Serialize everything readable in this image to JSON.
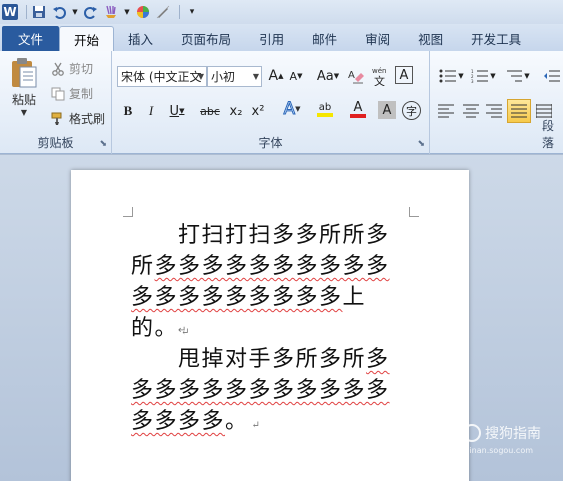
{
  "quick_access": {
    "app_icon": "word-logo",
    "items": [
      "save-icon",
      "undo-icon",
      "redo-icon",
      "format-painter-icon",
      "color-wheel-icon",
      "pen-icon",
      "customize-icon"
    ]
  },
  "tabs": [
    "文件",
    "开始",
    "插入",
    "页面布局",
    "引用",
    "邮件",
    "审阅",
    "视图",
    "开发工具"
  ],
  "ribbon": {
    "clipboard": {
      "label": "剪贴板",
      "paste": "粘贴",
      "cut": "剪切",
      "copy": "复制",
      "format_painter": "格式刷"
    },
    "font": {
      "label": "字体",
      "font_name": "宋体 (中文正文",
      "font_size": "小初",
      "grow": "A",
      "shrink": "A",
      "change_case": "Aa",
      "clear": "A",
      "phonetic": "wén",
      "border": "A",
      "bold": "B",
      "italic": "I",
      "underline": "U",
      "strike": "abc",
      "subscript": "x₂",
      "superscript": "x²",
      "effects": "A",
      "highlight": "ab",
      "font_color": "A",
      "char_shading": "A",
      "enclose": "字",
      "accent_red": "#e02020",
      "highlight_yellow": "#f5e600"
    },
    "paragraph": {
      "label": "段落"
    }
  },
  "document": {
    "paragraph1": {
      "plain": "　　打扫打扫多多所所多所",
      "wavy": "多多多多多多多多多多多多多多多多多多多",
      "tail": "上的。"
    },
    "paragraph2": {
      "plain": "　　甩掉对手多所多所",
      "wavy": "多多多多多多多多多多多多多多多多",
      "tail": "。"
    },
    "para_mark": "↵"
  },
  "watermark": {
    "text": "搜狗指南",
    "url": "zhinan.sogou.com"
  }
}
